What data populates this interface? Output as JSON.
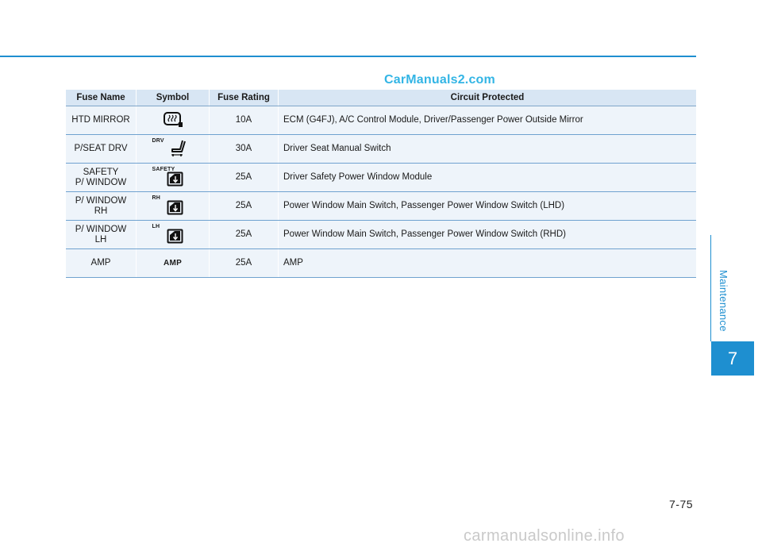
{
  "watermark_top": "CarManuals2.com",
  "table": {
    "headers": [
      "Fuse Name",
      "Symbol",
      "Fuse Rating",
      "Circuit Protected"
    ],
    "rows": [
      {
        "name": "HTD MIRROR",
        "symbol_icon": "heated-mirror-icon",
        "symbol_text": "",
        "rating": "10A",
        "circuit": "ECM (G4FJ), A/C Control Module, Driver/Passenger Power Outside Mirror"
      },
      {
        "name": "P/SEAT DRV",
        "symbol_icon": "power-seat-icon",
        "symbol_text": "DRV",
        "rating": "30A",
        "circuit": "Driver Seat Manual Switch"
      },
      {
        "name": "SAFETY\nP/ WINDOW",
        "symbol_icon": "power-window-icon",
        "symbol_text": "SAFETY",
        "rating": "25A",
        "circuit": "Driver Safety Power Window Module"
      },
      {
        "name": "P/ WINDOW\nRH",
        "symbol_icon": "power-window-icon",
        "symbol_text": "RH",
        "rating": "25A",
        "circuit": "Power Window Main Switch, Passenger Power Window Switch (LHD)"
      },
      {
        "name": "P/ WINDOW\nLH",
        "symbol_icon": "power-window-icon",
        "symbol_text": "LH",
        "rating": "25A",
        "circuit": "Power Window Main Switch, Passenger Power Window Switch (RHD)"
      },
      {
        "name": "AMP",
        "symbol_icon": "amp-text-symbol",
        "symbol_text": "AMP",
        "rating": "25A",
        "circuit": "AMP"
      }
    ]
  },
  "side_label": "Maintenance",
  "chapter_number": "7",
  "page_number": "7-75",
  "watermark_bottom": "carmanualsonline.info",
  "colors": {
    "accent": "#1e8fd0",
    "header_bg": "#d8e6f4",
    "row_bg": "#eef4fa"
  }
}
